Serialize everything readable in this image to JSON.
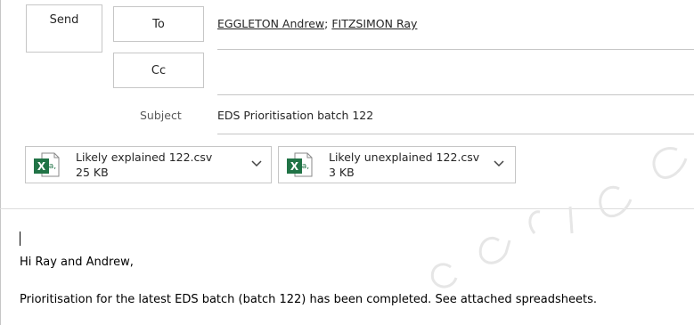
{
  "toolbar": {
    "send_label": "Send"
  },
  "header": {
    "to_button_label": "To",
    "cc_button_label": "Cc",
    "subject_label": "Subject",
    "recipients": [
      "EGGLETON Andrew",
      "FITZSIMON Ray"
    ],
    "recipient_separator": "; ",
    "cc_value": "",
    "subject_value": "EDS Prioritisation batch 122"
  },
  "attachments": [
    {
      "name": "Likely explained 122.csv",
      "size": "25 KB",
      "icon": "excel-csv-icon"
    },
    {
      "name": "Likely unexplained 122.csv",
      "size": "3 KB",
      "icon": "excel-csv-icon"
    }
  ],
  "body": {
    "greeting": "Hi Ray and Andrew,",
    "message": "Prioritisation for the latest EDS batch (batch 122) has been completed. See attached spreadsheets."
  },
  "colors": {
    "border": "#c6c6c6",
    "excel_green": "#217346",
    "text": "#262626",
    "watermark": "#e6e6e6"
  }
}
